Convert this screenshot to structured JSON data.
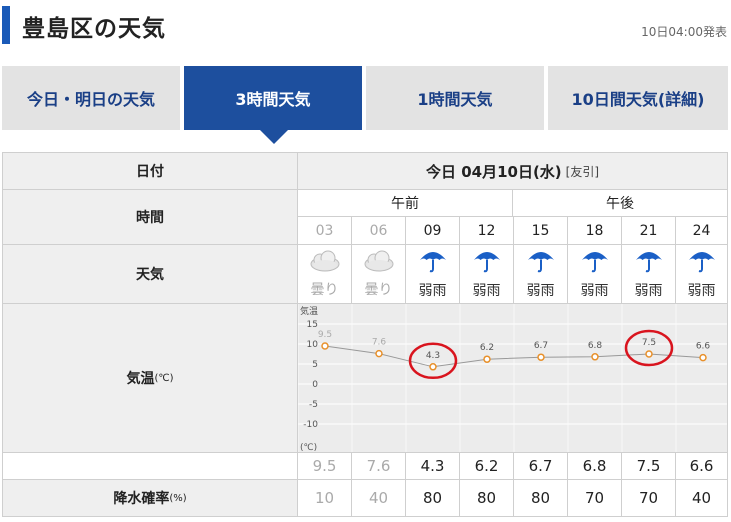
{
  "header": {
    "title": "豊島区の天気",
    "published": "10日04:00発表"
  },
  "tabs": [
    {
      "label": "今日・明日の天気",
      "active": false
    },
    {
      "label": "3時間天気",
      "active": true
    },
    {
      "label": "1時間天気",
      "active": false
    },
    {
      "label": "10日間天気(詳細)",
      "active": false
    }
  ],
  "table": {
    "date_label": "日付",
    "date_value": "今日 04月10日(水)",
    "date_note": "[友引]",
    "time_label": "時間",
    "am_label": "午前",
    "pm_label": "午後",
    "weather_label": "天気",
    "temp_label": "気温",
    "temp_unit": "(℃)",
    "precip_label": "降水確率",
    "precip_unit": "(%)",
    "hours": [
      "03",
      "06",
      "09",
      "12",
      "15",
      "18",
      "21",
      "24"
    ],
    "weather": [
      "曇り",
      "曇り",
      "弱雨",
      "弱雨",
      "弱雨",
      "弱雨",
      "弱雨",
      "弱雨"
    ],
    "weather_icons": [
      "cloud-icon",
      "cloud-icon",
      "umbrella-icon",
      "umbrella-icon",
      "umbrella-icon",
      "umbrella-icon",
      "umbrella-icon",
      "umbrella-icon"
    ],
    "temps": [
      "9.5",
      "7.6",
      "4.3",
      "6.2",
      "6.7",
      "6.8",
      "7.5",
      "6.6"
    ],
    "precip": [
      "10",
      "40",
      "80",
      "80",
      "80",
      "70",
      "70",
      "40"
    ],
    "past_columns": 2
  },
  "chart_data": {
    "type": "line",
    "axis_title": "気温",
    "axis_unit": "(℃)",
    "x": [
      "03",
      "06",
      "09",
      "12",
      "15",
      "18",
      "21",
      "24"
    ],
    "values": [
      9.5,
      7.6,
      4.3,
      6.2,
      6.7,
      6.8,
      7.5,
      6.6
    ],
    "value_labels": [
      "9.5",
      "7.6",
      "4.3",
      "6.2",
      "6.7",
      "6.8",
      "7.5",
      "6.6"
    ],
    "ylim": [
      -15,
      15
    ],
    "yticks": [
      "15",
      "10",
      "5",
      "0",
      "-5",
      "-10"
    ],
    "ytick_values": [
      15,
      10,
      5,
      0,
      -5,
      -10
    ],
    "highlighted_points": [
      "09",
      "21"
    ],
    "colors": {
      "line": "#999999",
      "marker": "#e8902a",
      "highlight": "#d9141e",
      "tab_active": "#1d4f9e",
      "accent": "#1a5ab8"
    }
  }
}
